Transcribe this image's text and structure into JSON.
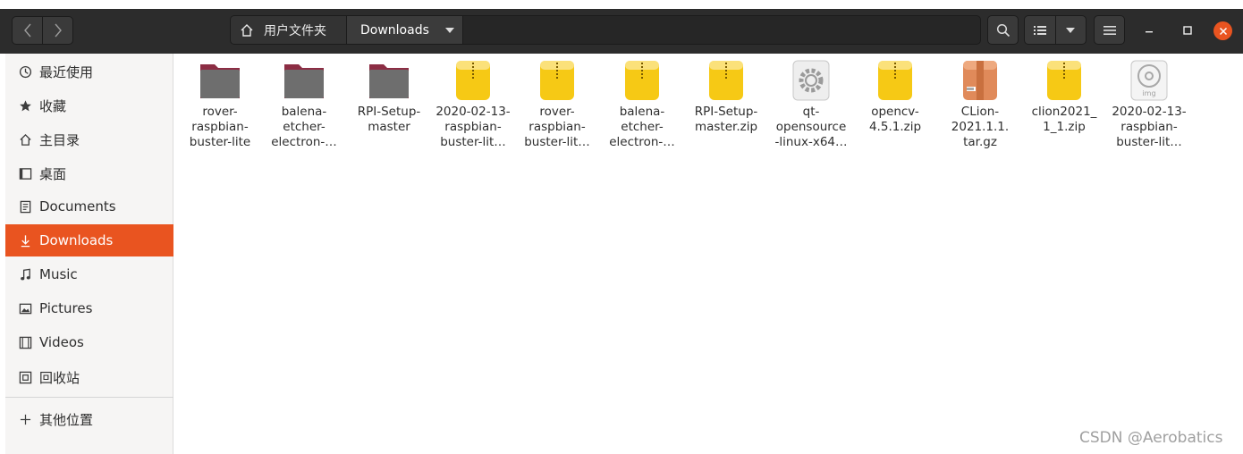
{
  "nav": {
    "back": "back-arrow",
    "forward": "forward-arrow"
  },
  "pathbar": {
    "home_label": "用户文件夹",
    "current_label": "Downloads"
  },
  "toolbar": {
    "search_icon": "search-icon",
    "view_icon": "list-view-icon",
    "menu_icon": "hamburger-icon"
  },
  "window": {
    "minimize": "–",
    "maximize": "□",
    "close": "×"
  },
  "sidebar": {
    "items": [
      {
        "label": "最近使用",
        "icon": "clock-icon"
      },
      {
        "label": "收藏",
        "icon": "star-icon"
      },
      {
        "label": "主目录",
        "icon": "home-icon"
      },
      {
        "label": "桌面",
        "icon": "desktop-icon"
      },
      {
        "label": "Documents",
        "icon": "document-icon"
      },
      {
        "label": "Downloads",
        "icon": "download-icon",
        "active": true
      },
      {
        "label": "Music",
        "icon": "music-icon"
      },
      {
        "label": "Pictures",
        "icon": "picture-icon"
      },
      {
        "label": "Videos",
        "icon": "video-icon"
      },
      {
        "label": "回收站",
        "icon": "trash-icon"
      },
      {
        "label": "其他位置",
        "icon": "plus-icon"
      }
    ]
  },
  "files": [
    {
      "name": "rover-\nraspbian-\nbuster-lite",
      "type": "folder"
    },
    {
      "name": "balena-\netcher-\nelectron-…",
      "type": "folder"
    },
    {
      "name": "RPI-Setup-\nmaster",
      "type": "folder"
    },
    {
      "name": "2020-02-13-\nraspbian-\nbuster-lit…",
      "type": "zip"
    },
    {
      "name": "rover-\nraspbian-\nbuster-lit…",
      "type": "zip"
    },
    {
      "name": "balena-\netcher-\nelectron-…",
      "type": "zip"
    },
    {
      "name": "RPI-Setup-\nmaster.zip",
      "type": "zip"
    },
    {
      "name": "qt-\nopensource\n-linux-x64…",
      "type": "executable"
    },
    {
      "name": "opencv-\n4.5.1.zip",
      "type": "zip"
    },
    {
      "name": "CLion-\n2021.1.1.\ntar.gz",
      "type": "archive"
    },
    {
      "name": "clion2021_\n1_1.zip",
      "type": "zip"
    },
    {
      "name": "2020-02-13-\nraspbian-\nbuster-lit…",
      "type": "img",
      "badge": "img"
    }
  ],
  "watermark": "CSDN @Aerobatics",
  "colors": {
    "accent": "#e95420",
    "header": "#2c2c2c",
    "sidebar": "#f6f5f4"
  }
}
